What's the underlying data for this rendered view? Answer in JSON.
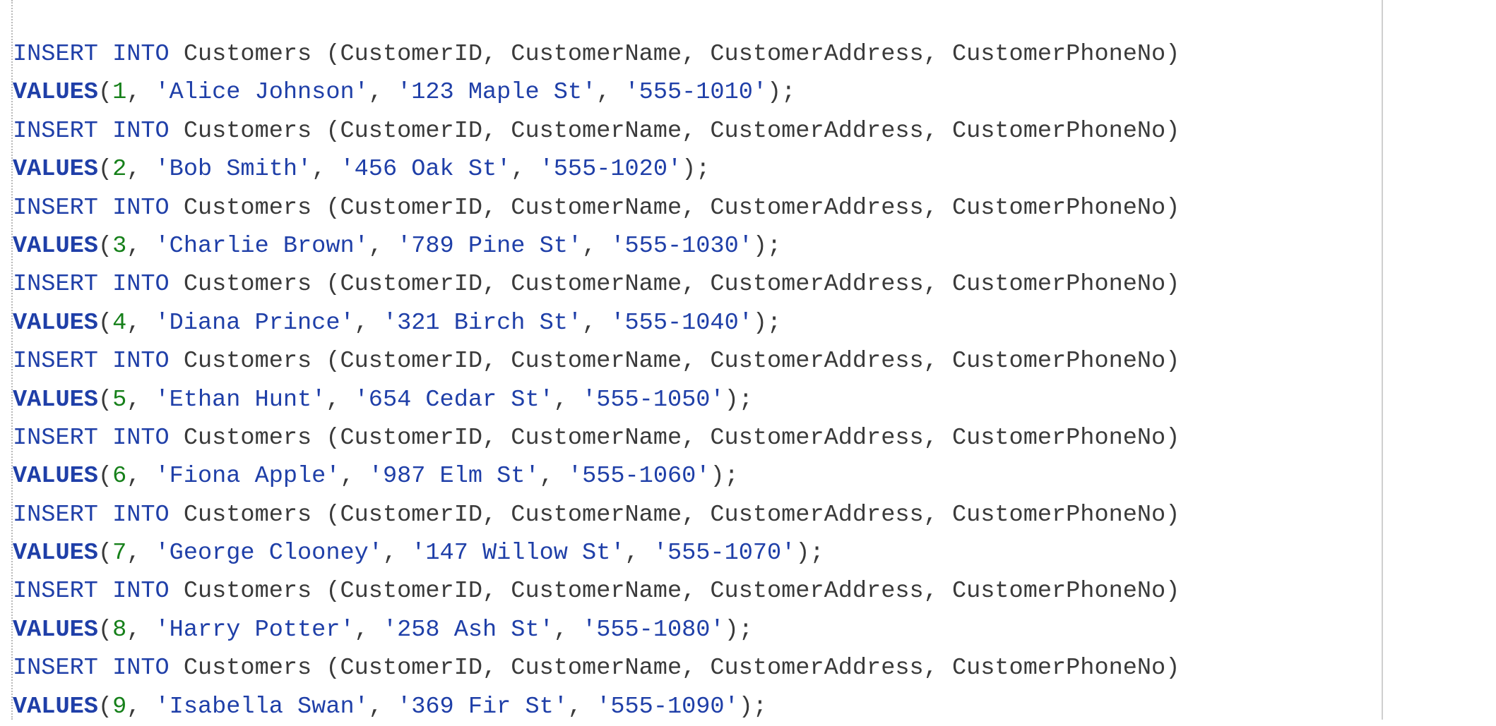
{
  "editor": {
    "lines": [
      {
        "type": "insert",
        "k1": "INSERT",
        "k2": "INTO",
        "table": "Customers",
        "cols": "(CustomerID, CustomerName, CustomerAddress, CustomerPhoneNo)"
      },
      {
        "type": "values",
        "kw": "VALUES",
        "id": "1",
        "name": "'Alice Johnson'",
        "addr": "'123 Maple St'",
        "phone": "'555-1010'"
      },
      {
        "type": "insert",
        "k1": "INSERT",
        "k2": "INTO",
        "table": "Customers",
        "cols": "(CustomerID, CustomerName, CustomerAddress, CustomerPhoneNo)"
      },
      {
        "type": "values",
        "kw": "VALUES",
        "id": "2",
        "name": "'Bob Smith'",
        "addr": "'456 Oak St'",
        "phone": "'555-1020'"
      },
      {
        "type": "insert",
        "k1": "INSERT",
        "k2": "INTO",
        "table": "Customers",
        "cols": "(CustomerID, CustomerName, CustomerAddress, CustomerPhoneNo)"
      },
      {
        "type": "values",
        "kw": "VALUES",
        "id": "3",
        "name": "'Charlie Brown'",
        "addr": "'789 Pine St'",
        "phone": "'555-1030'"
      },
      {
        "type": "insert",
        "k1": "INSERT",
        "k2": "INTO",
        "table": "Customers",
        "cols": "(CustomerID, CustomerName, CustomerAddress, CustomerPhoneNo)"
      },
      {
        "type": "values",
        "kw": "VALUES",
        "id": "4",
        "name": "'Diana Prince'",
        "addr": "'321 Birch St'",
        "phone": "'555-1040'"
      },
      {
        "type": "insert",
        "k1": "INSERT",
        "k2": "INTO",
        "table": "Customers",
        "cols": "(CustomerID, CustomerName, CustomerAddress, CustomerPhoneNo)"
      },
      {
        "type": "values",
        "kw": "VALUES",
        "id": "5",
        "name": "'Ethan Hunt'",
        "addr": "'654 Cedar St'",
        "phone": "'555-1050'"
      },
      {
        "type": "insert",
        "k1": "INSERT",
        "k2": "INTO",
        "table": "Customers",
        "cols": "(CustomerID, CustomerName, CustomerAddress, CustomerPhoneNo)"
      },
      {
        "type": "values",
        "kw": "VALUES",
        "id": "6",
        "name": "'Fiona Apple'",
        "addr": "'987 Elm St'",
        "phone": "'555-1060'"
      },
      {
        "type": "insert",
        "k1": "INSERT",
        "k2": "INTO",
        "table": "Customers",
        "cols": "(CustomerID, CustomerName, CustomerAddress, CustomerPhoneNo)"
      },
      {
        "type": "values",
        "kw": "VALUES",
        "id": "7",
        "name": "'George Clooney'",
        "addr": "'147 Willow St'",
        "phone": "'555-1070'"
      },
      {
        "type": "insert",
        "k1": "INSERT",
        "k2": "INTO",
        "table": "Customers",
        "cols": "(CustomerID, CustomerName, CustomerAddress, CustomerPhoneNo)"
      },
      {
        "type": "values",
        "kw": "VALUES",
        "id": "8",
        "name": "'Harry Potter'",
        "addr": "'258 Ash St'",
        "phone": "'555-1080'"
      },
      {
        "type": "insert",
        "k1": "INSERT",
        "k2": "INTO",
        "table": "Customers",
        "cols": "(CustomerID, CustomerName, CustomerAddress, CustomerPhoneNo)"
      },
      {
        "type": "values",
        "kw": "VALUES",
        "id": "9",
        "name": "'Isabella Swan'",
        "addr": "'369 Fir St'",
        "phone": "'555-1090'"
      }
    ]
  },
  "colors": {
    "keyword": "#1f3fa8",
    "identifier": "#3a3a3a",
    "number": "#16801a",
    "string": "#1f3fa8"
  }
}
